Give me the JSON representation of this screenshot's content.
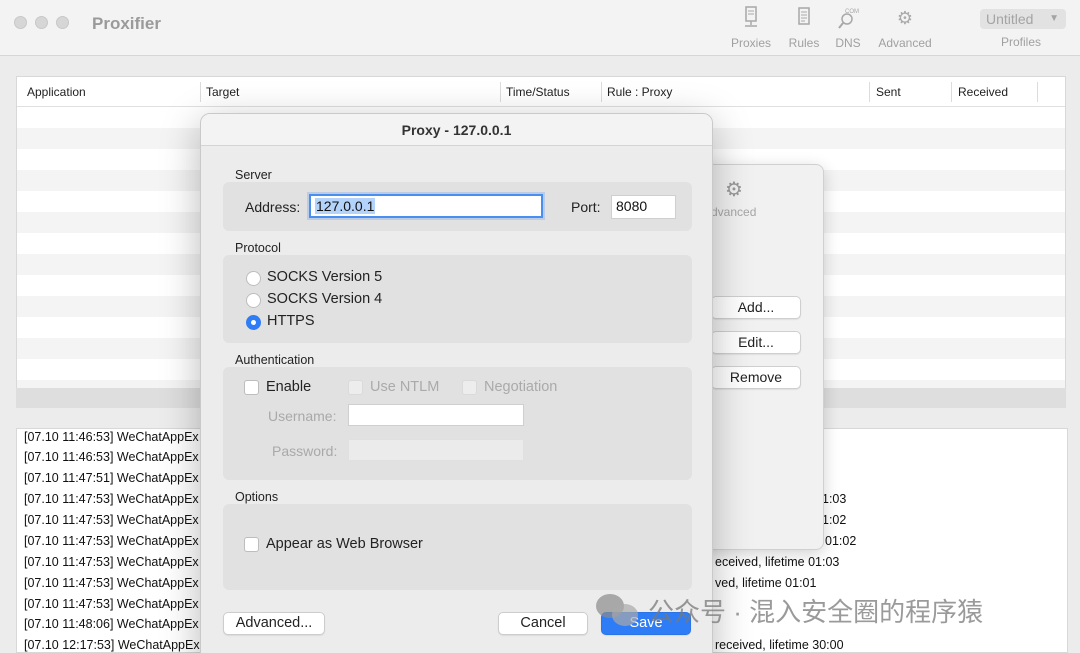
{
  "app": {
    "title": "Proxifier"
  },
  "toolbar": {
    "items": [
      {
        "label": "Proxies",
        "icon": "proxies-icon"
      },
      {
        "label": "Rules",
        "icon": "rules-icon"
      },
      {
        "label": "DNS",
        "icon": "dns-icon",
        "icon_text": "COM"
      },
      {
        "label": "Advanced",
        "icon": "gear-icon"
      }
    ],
    "profile": {
      "value": "Untitled",
      "label": "Profiles"
    }
  },
  "connections": {
    "columns": [
      "Application",
      "Target",
      "Time/Status",
      "Rule : Proxy",
      "Sent",
      "Received"
    ]
  },
  "log": {
    "lines": [
      "[07.10 11:46:53] WeChatAppEx",
      "[07.10 11:46:53] WeChatAppEx",
      "[07.10 11:47:51] WeChatAppEx",
      "[07.10 11:47:53] WeChatAppEx",
      "[07.10 11:47:53] WeChatAppEx",
      "[07.10 11:47:53] WeChatAppEx",
      "[07.10 11:47:53] WeChatAppEx",
      "[07.10 11:47:53] WeChatAppEx",
      "[07.10 11:47:53] WeChatAppEx",
      "[07.10 11:48:06] WeChatAppEx",
      "[07.10 12:17:53] WeChatAppEx"
    ],
    "tails": [
      "1:03",
      "1:02",
      "01:02",
      "eceived, lifetime 01:03",
      "ved, lifetime 01:01",
      "received, lifetime 30:00"
    ]
  },
  "proxies_sheet": {
    "advanced_label": "Advanced",
    "add_label": "Add...",
    "edit_label": "Edit...",
    "remove_label": "Remove"
  },
  "dialog": {
    "title": "Proxy - 127.0.0.1",
    "server": {
      "section": "Server",
      "address_label": "Address:",
      "address_value": "127.0.0.1",
      "port_label": "Port:",
      "port_value": "8080"
    },
    "protocol": {
      "section": "Protocol",
      "options": [
        "SOCKS Version 5",
        "SOCKS Version 4",
        "HTTPS"
      ],
      "selected": "HTTPS"
    },
    "authentication": {
      "section": "Authentication",
      "enable_label": "Enable",
      "ntlm_label": "Use NTLM",
      "negotiation_label": "Negotiation",
      "username_label": "Username:",
      "password_label": "Password:"
    },
    "options": {
      "section": "Options",
      "web_browser_label": "Appear as Web Browser"
    },
    "buttons": {
      "advanced": "Advanced...",
      "cancel": "Cancel",
      "save": "Save"
    }
  },
  "watermark": {
    "text": "公众号 · 混入安全圈的程序猿"
  }
}
